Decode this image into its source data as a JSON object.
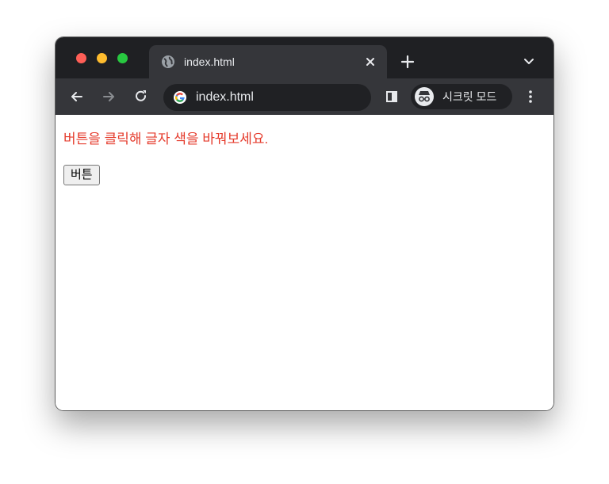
{
  "browser": {
    "tab": {
      "title": "index.html"
    },
    "address_bar": {
      "url": "index.html"
    },
    "incognito": {
      "label": "시크릿 모드"
    },
    "colors": {
      "tabstrip": "#1f2023",
      "toolbar": "#35363a",
      "active_tab": "#35363a",
      "omnibox": "#202124",
      "text": "#e8eaed",
      "traffic_red": "#ff5f57",
      "traffic_yellow": "#febc2e",
      "traffic_green": "#28c840"
    }
  },
  "page": {
    "message": "버튼을 클릭해 글자 색을 바꿔보세요.",
    "message_color": "#e53b2c",
    "button_label": "버튼"
  },
  "icons": [
    "globe-icon",
    "close-icon",
    "plus-icon",
    "chevron-down-icon",
    "back-arrow-icon",
    "forward-arrow-icon",
    "reload-icon",
    "google-icon",
    "side-panel-icon",
    "incognito-icon",
    "more-menu-icon"
  ]
}
